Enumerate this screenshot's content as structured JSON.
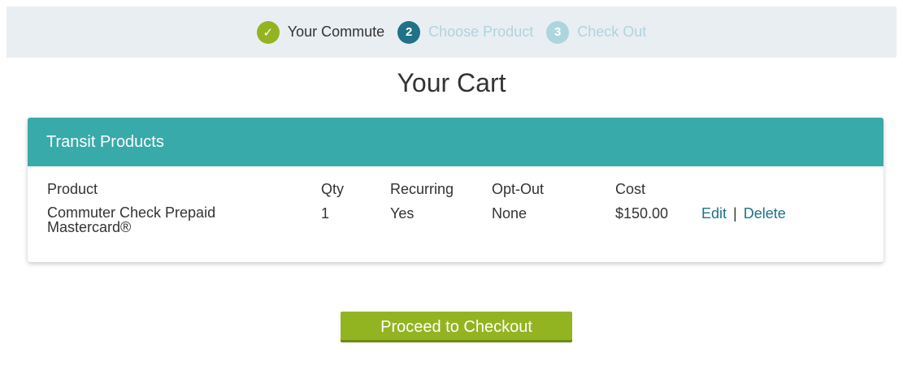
{
  "steps": [
    {
      "label": "Your Commute",
      "marker": "✓",
      "state": "done"
    },
    {
      "label": "Choose Product",
      "marker": "2",
      "state": "active"
    },
    {
      "label": "Check Out",
      "marker": "3",
      "state": "pending"
    }
  ],
  "page_title": "Your Cart",
  "cart": {
    "section_title": "Transit Products",
    "headers": {
      "product": "Product",
      "qty": "Qty",
      "recurring": "Recurring",
      "optout": "Opt-Out",
      "cost": "Cost"
    },
    "items": [
      {
        "product": "Commuter Check Prepaid Mastercard®",
        "qty": "1",
        "recurring": "Yes",
        "optout": "None",
        "cost": "$150.00",
        "edit_label": "Edit",
        "separator": "|",
        "delete_label": "Delete"
      }
    ]
  },
  "checkout_button": "Proceed to Checkout",
  "colors": {
    "step_done": "#93b421",
    "step_active": "#1f7287",
    "step_pending": "#aed4de",
    "header_bg": "#38aaa9",
    "link": "#1f7287",
    "button": "#93b421"
  }
}
